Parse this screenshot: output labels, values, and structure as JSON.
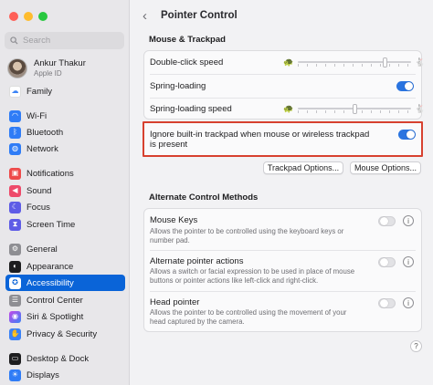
{
  "sidebar": {
    "search_placeholder": "Search",
    "profile": {
      "name": "Ankur Thakur",
      "subtitle": "Apple ID"
    },
    "items": [
      {
        "label": "Family",
        "icon": "family-icon",
        "color": "#ffffff"
      },
      {
        "label": "Wi-Fi",
        "icon": "wifi-icon",
        "color": "#2f7cf6"
      },
      {
        "label": "Bluetooth",
        "icon": "bluetooth-icon",
        "color": "#2f7cf6"
      },
      {
        "label": "Network",
        "icon": "network-icon",
        "color": "#2f7cf6"
      },
      {
        "label": "Notifications",
        "icon": "notifications-icon",
        "color": "#ee4a4a"
      },
      {
        "label": "Sound",
        "icon": "sound-icon",
        "color": "#ee4a6a"
      },
      {
        "label": "Focus",
        "icon": "focus-icon",
        "color": "#5e5ce6"
      },
      {
        "label": "Screen Time",
        "icon": "screen-time-icon",
        "color": "#5e5ce6"
      },
      {
        "label": "General",
        "icon": "general-icon",
        "color": "#8e8e93"
      },
      {
        "label": "Appearance",
        "icon": "appearance-icon",
        "color": "#1d1d1f"
      },
      {
        "label": "Accessibility",
        "icon": "accessibility-icon",
        "color": "#2f7cf6",
        "active": true
      },
      {
        "label": "Control Center",
        "icon": "control-center-icon",
        "color": "#8e8e93"
      },
      {
        "label": "Siri & Spotlight",
        "icon": "siri-icon",
        "color": "#c548e8"
      },
      {
        "label": "Privacy & Security",
        "icon": "privacy-icon",
        "color": "#3a82f6"
      },
      {
        "label": "Desktop & Dock",
        "icon": "desktop-dock-icon",
        "color": "#1d1d1f"
      },
      {
        "label": "Displays",
        "icon": "displays-icon",
        "color": "#2f7cf6"
      }
    ]
  },
  "header": {
    "title": "Pointer Control"
  },
  "mouse_trackpad": {
    "heading": "Mouse & Trackpad",
    "double_click_label": "Double-click speed",
    "double_click_value": 0.78,
    "spring_loading_label": "Spring-loading",
    "spring_loading_on": true,
    "spring_speed_label": "Spring-loading speed",
    "spring_speed_value": 0.5,
    "ignore_label_line1": "Ignore built-in trackpad when mouse or wireless trackpad",
    "ignore_label_line2": "is present",
    "ignore_on": true,
    "trackpad_options_label": "Trackpad Options...",
    "mouse_options_label": "Mouse Options..."
  },
  "alternate": {
    "heading": "Alternate Control Methods",
    "mouse_keys": {
      "label": "Mouse Keys",
      "desc": "Allows the pointer to be controlled using the keyboard keys or number pad."
    },
    "alt_pointer": {
      "label": "Alternate pointer actions",
      "desc": "Allows a switch or facial expression to be used in place of mouse buttons or pointer actions like left-click and right-click."
    },
    "head_pointer": {
      "label": "Head pointer",
      "desc": "Allows the pointer to be controlled using the movement of your head captured by the camera."
    }
  },
  "help_label": "?",
  "info_label": "i"
}
